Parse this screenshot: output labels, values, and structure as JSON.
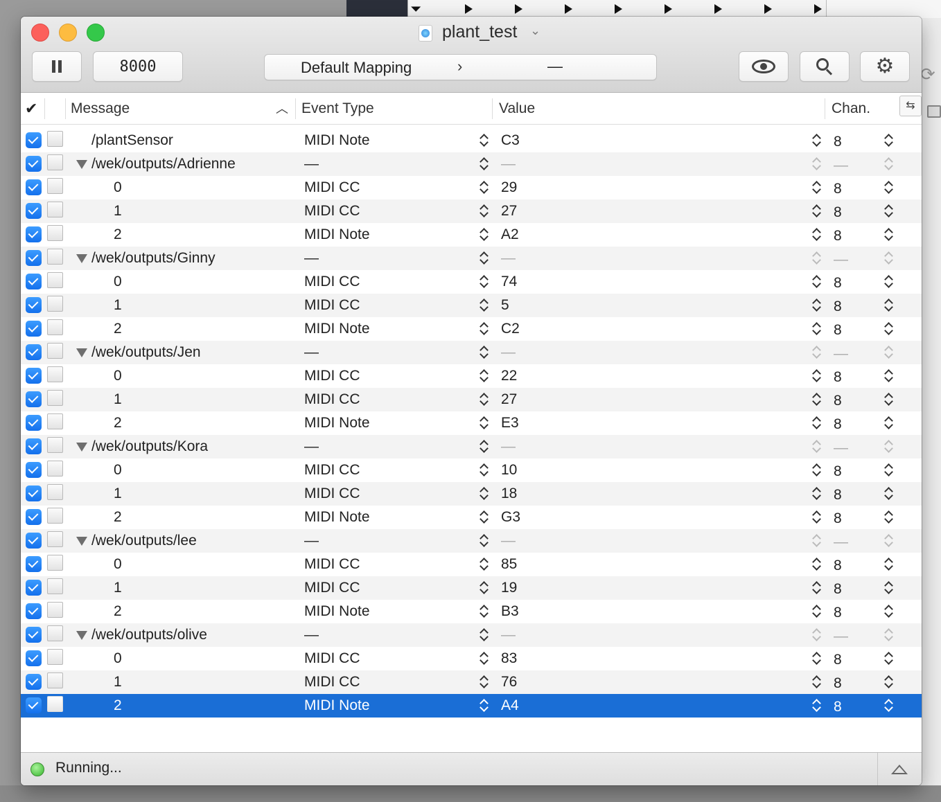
{
  "window": {
    "title": "plant_test"
  },
  "toolbar": {
    "port": "8000",
    "mapping_label": "Default Mapping",
    "mapping_value": "—"
  },
  "table": {
    "header_check": "✔",
    "columns": {
      "message": "Message",
      "event_type": "Event Type",
      "value": "Value",
      "channel": "Chan."
    },
    "rows": [
      {
        "message": "/plantSensor",
        "event": "MIDI Note",
        "value": "C3",
        "chan": "8",
        "group": false,
        "indent": false
      },
      {
        "message": "/wek/outputs/Adrienne",
        "event": "—",
        "value": "—",
        "chan": "—",
        "group": true,
        "indent": false
      },
      {
        "message": "0",
        "event": "MIDI CC",
        "value": "29",
        "chan": "8",
        "group": false,
        "indent": true
      },
      {
        "message": "1",
        "event": "MIDI CC",
        "value": "27",
        "chan": "8",
        "group": false,
        "indent": true
      },
      {
        "message": "2",
        "event": "MIDI Note",
        "value": "A2",
        "chan": "8",
        "group": false,
        "indent": true
      },
      {
        "message": "/wek/outputs/Ginny",
        "event": "—",
        "value": "—",
        "chan": "—",
        "group": true,
        "indent": false
      },
      {
        "message": "0",
        "event": "MIDI CC",
        "value": "74",
        "chan": "8",
        "group": false,
        "indent": true
      },
      {
        "message": "1",
        "event": "MIDI CC",
        "value": "5",
        "chan": "8",
        "group": false,
        "indent": true
      },
      {
        "message": "2",
        "event": "MIDI Note",
        "value": "C2",
        "chan": "8",
        "group": false,
        "indent": true
      },
      {
        "message": "/wek/outputs/Jen",
        "event": "—",
        "value": "—",
        "chan": "—",
        "group": true,
        "indent": false
      },
      {
        "message": "0",
        "event": "MIDI CC",
        "value": "22",
        "chan": "8",
        "group": false,
        "indent": true
      },
      {
        "message": "1",
        "event": "MIDI CC",
        "value": "27",
        "chan": "8",
        "group": false,
        "indent": true
      },
      {
        "message": "2",
        "event": "MIDI Note",
        "value": "E3",
        "chan": "8",
        "group": false,
        "indent": true
      },
      {
        "message": "/wek/outputs/Kora",
        "event": "—",
        "value": "—",
        "chan": "—",
        "group": true,
        "indent": false
      },
      {
        "message": "0",
        "event": "MIDI CC",
        "value": "10",
        "chan": "8",
        "group": false,
        "indent": true
      },
      {
        "message": "1",
        "event": "MIDI CC",
        "value": "18",
        "chan": "8",
        "group": false,
        "indent": true
      },
      {
        "message": "2",
        "event": "MIDI Note",
        "value": "G3",
        "chan": "8",
        "group": false,
        "indent": true
      },
      {
        "message": "/wek/outputs/lee",
        "event": "—",
        "value": "—",
        "chan": "—",
        "group": true,
        "indent": false
      },
      {
        "message": "0",
        "event": "MIDI CC",
        "value": "85",
        "chan": "8",
        "group": false,
        "indent": true
      },
      {
        "message": "1",
        "event": "MIDI CC",
        "value": "19",
        "chan": "8",
        "group": false,
        "indent": true
      },
      {
        "message": "2",
        "event": "MIDI Note",
        "value": "B3",
        "chan": "8",
        "group": false,
        "indent": true
      },
      {
        "message": "/wek/outputs/olive",
        "event": "—",
        "value": "—",
        "chan": "—",
        "group": true,
        "indent": false
      },
      {
        "message": "0",
        "event": "MIDI CC",
        "value": "83",
        "chan": "8",
        "group": false,
        "indent": true
      },
      {
        "message": "1",
        "event": "MIDI CC",
        "value": "76",
        "chan": "8",
        "group": false,
        "indent": true
      },
      {
        "message": "2",
        "event": "MIDI Note",
        "value": "A4",
        "chan": "8",
        "group": false,
        "indent": true,
        "selected": true
      }
    ]
  },
  "status": {
    "text": "Running...",
    "indicator_color": "#36b52d"
  },
  "colors": {
    "selection": "#1a6ed6",
    "checkbox": "#1470ec"
  }
}
